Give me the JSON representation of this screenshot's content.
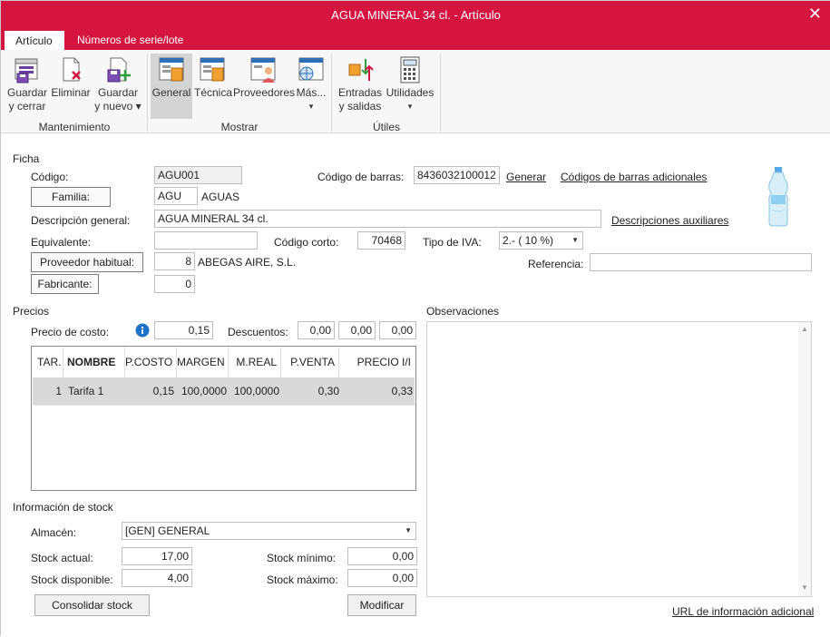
{
  "window": {
    "title": "AGUA MINERAL 34 cl. - Artículo",
    "close_glyph": "✕"
  },
  "tabs": [
    {
      "label": "Artículo"
    },
    {
      "label": "Números de serie/lote"
    }
  ],
  "ribbon": {
    "buttons": {
      "guardar_cerrar": {
        "line1": "Guardar",
        "line2": "y cerrar"
      },
      "eliminar": {
        "line1": "Eliminar"
      },
      "guardar_nuevo": {
        "line1": "Guardar",
        "line2": "y nuevo ▾"
      },
      "general": {
        "line1": "General"
      },
      "tecnica": {
        "line1": "Técnica"
      },
      "proveedores": {
        "line1": "Proveedores"
      },
      "mas": {
        "line1": "Más...",
        "line2": "▾"
      },
      "entradas_salidas": {
        "line1": "Entradas",
        "line2": "y salidas"
      },
      "utilidades": {
        "line1": "Utilidades",
        "line2": "▾"
      }
    },
    "groups": {
      "mantenimiento": "Mantenimiento",
      "mostrar": "Mostrar",
      "utiles": "Útiles"
    }
  },
  "ficha": {
    "section": "Ficha",
    "codigo_label": "Código:",
    "codigo_value": "AGU001",
    "codigo_barras_label": "Código de barras:",
    "codigo_barras_value": "8436032100012",
    "generar_link": "Generar",
    "codigos_adicionales_link": "Códigos de barras adicionales",
    "familia_button": "Familia:",
    "familia_code": "AGU",
    "familia_name": "AGUAS",
    "descripcion_label": "Descripción general:",
    "descripcion_value": "AGUA MINERAL 34 cl.",
    "descripciones_aux_link": "Descripciones auxiliares",
    "equivalente_label": "Equivalente:",
    "equivalente_value": "",
    "codigo_corto_label": "Código corto:",
    "codigo_corto_value": "70468",
    "tipo_iva_label": "Tipo de IVA:",
    "tipo_iva_value": "2.- ( 10 %)",
    "proveedor_button": "Proveedor habitual:",
    "proveedor_code": "8",
    "proveedor_name": "ABEGAS AIRE, S.L.",
    "referencia_label": "Referencia:",
    "referencia_value": "",
    "fabricante_button": "Fabricante:",
    "fabricante_value": "0"
  },
  "precios": {
    "section": "Precios",
    "precio_costo_label": "Precio de costo:",
    "precio_costo_value": "0,15",
    "descuentos_label": "Descuentos:",
    "descuentos": [
      "0,00",
      "0,00",
      "0,00"
    ],
    "columns": [
      "TAR.",
      "NOMBRE",
      "P.COSTO",
      "MARGEN",
      "M.REAL",
      "P.VENTA",
      "PRECIO I/I"
    ],
    "rows": [
      {
        "tar": "1",
        "nombre": "Tarifa 1",
        "pcosto": "0,15",
        "margen": "100,0000",
        "mreal": "100,0000",
        "pventa": "0,30",
        "precio_ii": "0,33"
      }
    ]
  },
  "observaciones": {
    "section": "Observaciones",
    "text": ""
  },
  "stock": {
    "section": "Información de stock",
    "almacen_label": "Almacén:",
    "almacen_value": "[GEN] GENERAL",
    "stock_actual_label": "Stock actual:",
    "stock_actual_value": "17,00",
    "stock_disponible_label": "Stock disponible:",
    "stock_disponible_value": "4,00",
    "stock_minimo_label": "Stock mínimo:",
    "stock_minimo_value": "0,00",
    "stock_maximo_label": "Stock máximo:",
    "stock_maximo_value": "0,00",
    "consolidar_button": "Consolidar stock",
    "modificar_button": "Modificar"
  },
  "url_info_link": "URL de información adicional",
  "icons": {
    "save_close": "save-close-icon",
    "delete": "delete-icon",
    "save_new": "save-new-icon",
    "info": "info-icon",
    "product_image": "water-bottle-image"
  },
  "colors": {
    "accent": "#d5143f",
    "ribbon_bg": "#f7f7f7",
    "selected_row": "#d9d9d9",
    "info_blue": "#1e73c8"
  }
}
